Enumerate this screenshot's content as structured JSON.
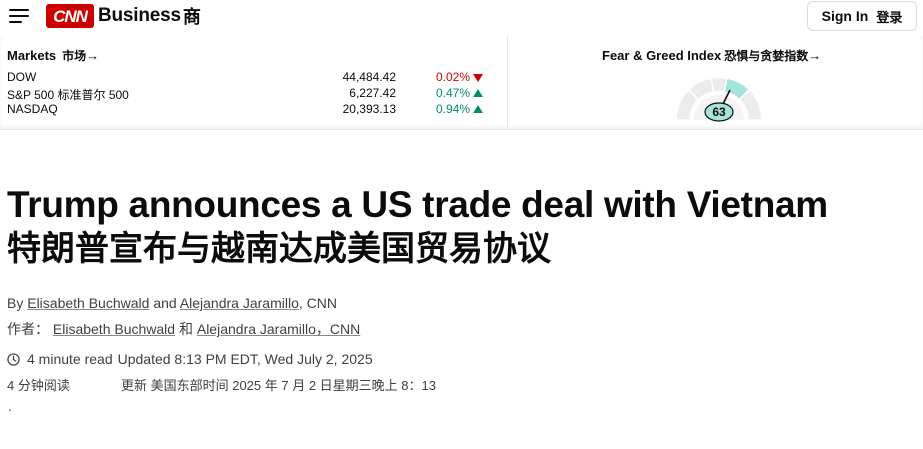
{
  "header": {
    "logo_text": "CNN",
    "section": "Business",
    "section_cn": "商",
    "signin_label": "Sign In",
    "signin_cn": "登录"
  },
  "markets": {
    "title": "Markets",
    "title_cn": "市场",
    "arrow": "→",
    "rows": [
      {
        "name": "DOW",
        "value": "44,484.42",
        "change": "0.02%",
        "direction": "down"
      },
      {
        "name": "S&P 500 标准普尔 500",
        "value": "6,227.42",
        "change": "0.47%",
        "direction": "up"
      },
      {
        "name": "NASDAQ",
        "value": "20,393.13",
        "change": "0.94%",
        "direction": "up"
      }
    ]
  },
  "fear_greed": {
    "title": "Fear & Greed Index",
    "title_cn": "恐惧与贪婪指数",
    "arrow": "→",
    "value": "63"
  },
  "article": {
    "headline": "Trump announces a US trade deal with Vietnam",
    "headline_cn": "特朗普宣布与越南达成美国贸易协议",
    "byline_prefix": "By",
    "author1": "Elisabeth Buchwald",
    "byline_and": "and",
    "author2": "Alejandra Jaramillo",
    "byline_org": ", CNN",
    "byline_cn_prefix": "作者：",
    "author1_cn": "Elisabeth Buchwald",
    "byline_cn_and": "和",
    "author2_cn": "Alejandra Jaramillo，CNN",
    "read_time": "4 minute read",
    "updated": "Updated 8:13 PM EDT, Wed July 2, 2025",
    "read_time_cn": "4 分钟阅读",
    "updated_cn": "更新 美国东部时间 2025 年 7 月 2 日星期三晚上 8：13",
    "trailing": "."
  },
  "colors": {
    "brand_red": "#cc0000",
    "positive_green": "#068d6d",
    "gauge_active": "#a6e3dd"
  }
}
